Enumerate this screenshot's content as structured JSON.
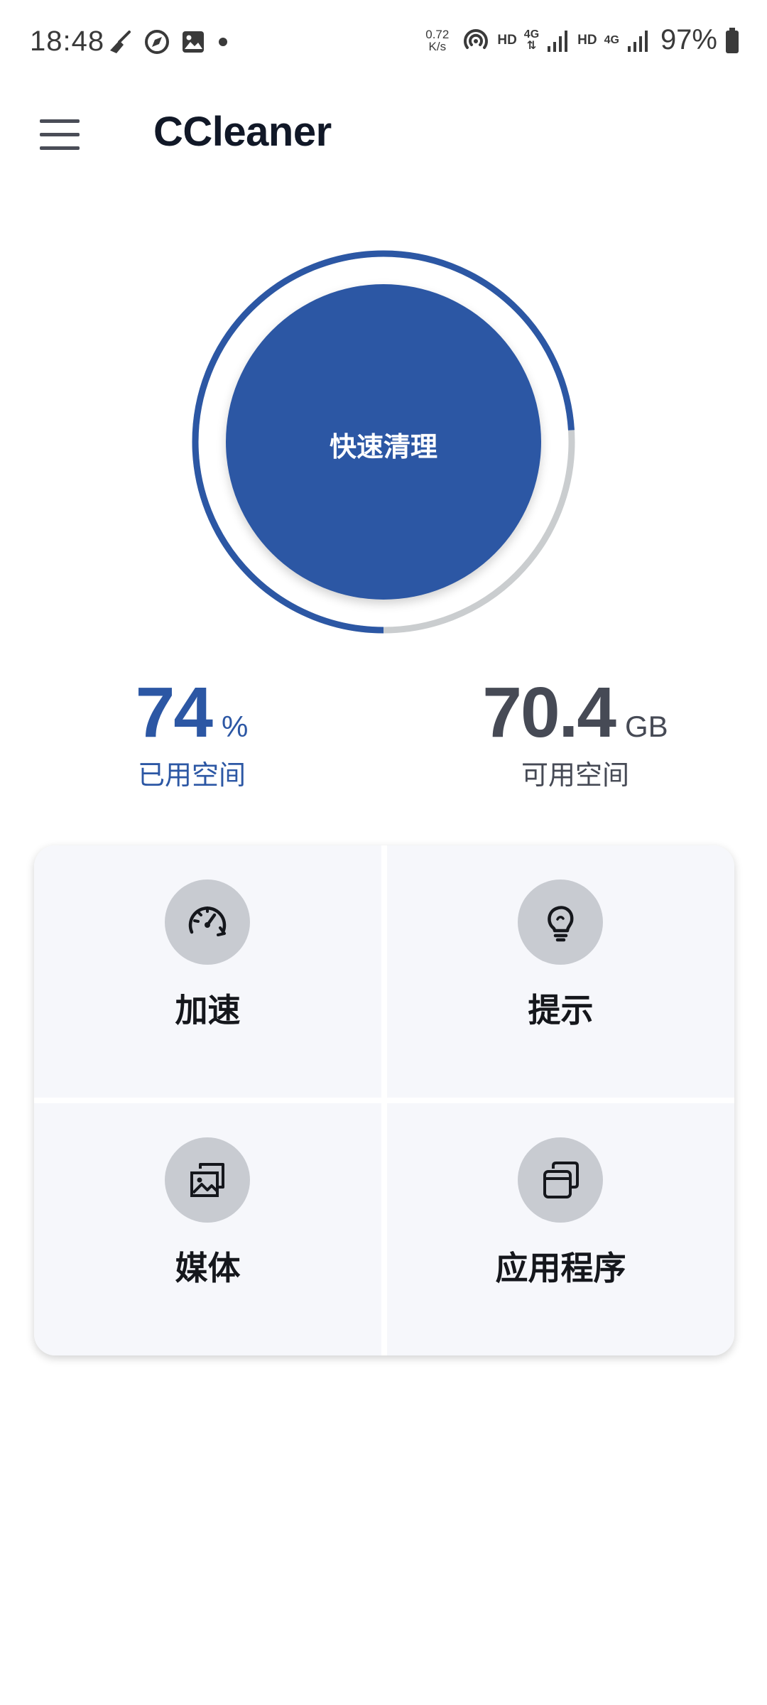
{
  "status_bar": {
    "time": "18:48",
    "left_icons": [
      "broom-icon",
      "compass-icon",
      "image-icon",
      "dot-icon"
    ],
    "net_speed_value": "0.72",
    "net_speed_unit": "K/s",
    "hd_1": "HD",
    "net_1": "4G",
    "hd_2": "HD",
    "net_2": "4G",
    "battery_percent": "97%"
  },
  "app_bar": {
    "title": "CCleaner",
    "menu_icon": "menu-icon"
  },
  "gauge": {
    "button_label": "快速清理",
    "used_fraction": 0.74,
    "used_color": "#2c57a4",
    "free_color": "#cacdcf"
  },
  "stats": {
    "used": {
      "value": "74",
      "unit": "%",
      "label": "已用空间"
    },
    "free": {
      "value": "70.4",
      "unit": "GB",
      "label": "可用空间"
    }
  },
  "tiles": [
    {
      "label": "加速",
      "icon": "speedometer-icon"
    },
    {
      "label": "提示",
      "icon": "lightbulb-icon"
    },
    {
      "label": "媒体",
      "icon": "gallery-icon"
    },
    {
      "label": "应用程序",
      "icon": "apps-icon"
    }
  ],
  "colors": {
    "accent": "#2c57a4",
    "tile_bg": "#f6f7fb",
    "icon_circle": "#c8cbd1"
  }
}
